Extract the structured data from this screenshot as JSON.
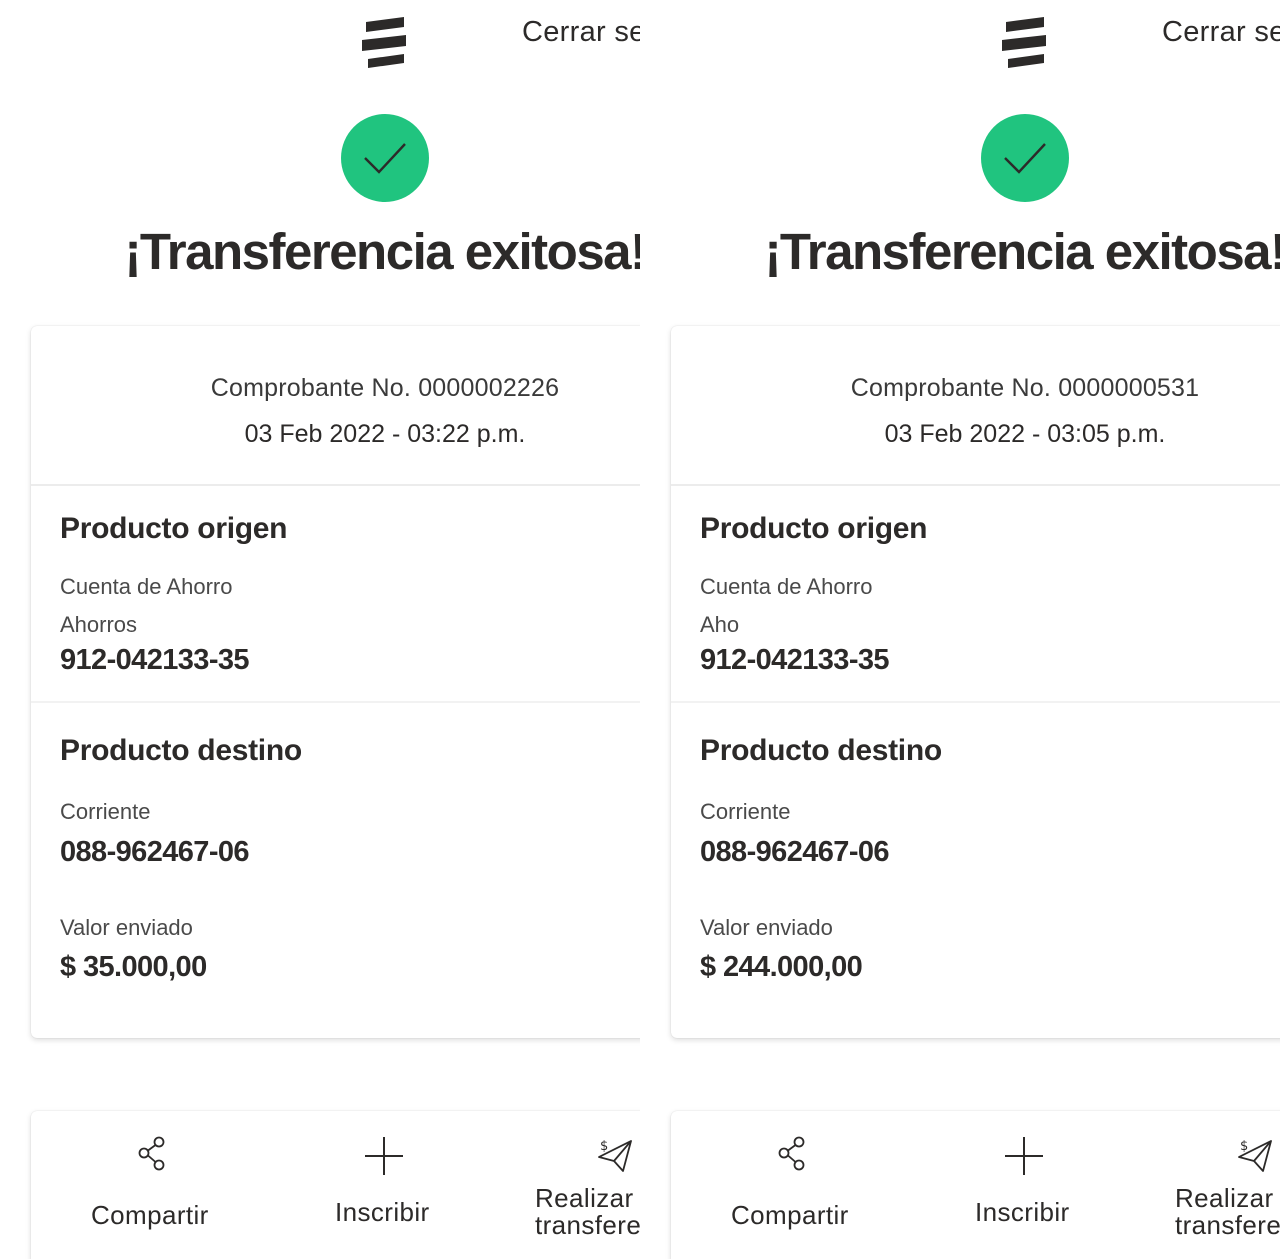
{
  "header": {
    "logout_label": "Cerrar se"
  },
  "title": "¡Transferencia exitosa!",
  "icons": {
    "logo": "bancolombia-logo",
    "success": "check-circle-icon",
    "share": "share-icon",
    "enroll": "plus-icon",
    "transfer": "send-money-icon"
  },
  "colors": {
    "success": "#20c47f",
    "text": "#2c2a29"
  },
  "receipts": [
    {
      "receipt_number": "Comprobante No. 0000002226",
      "datetime": "03 Feb 2022 - 03:22 p.m.",
      "origin": {
        "heading": "Producto origen",
        "type": "Cuenta de Ahorro",
        "subtype": "Ahorros",
        "account": "912-042133-35"
      },
      "destination": {
        "heading": "Producto destino",
        "type": "Corriente",
        "account": "088-962467-06"
      },
      "amount": {
        "label": "Valor enviado",
        "value": "$ 35.000,00"
      }
    },
    {
      "receipt_number": "Comprobante No. 0000000531",
      "datetime": "03 Feb 2022 - 03:05 p.m.",
      "origin": {
        "heading": "Producto origen",
        "type": "Cuenta de Ahorro",
        "subtype": "Aho",
        "account": "912-042133-35"
      },
      "destination": {
        "heading": "Producto destino",
        "type": "Corriente",
        "account": "088-962467-06"
      },
      "amount": {
        "label": "Valor enviado",
        "value": "$ 244.000,00"
      }
    }
  ],
  "actions": {
    "share_label": "Compartir",
    "enroll_label": "Inscribir",
    "transfer_label_line1": "Realizar",
    "transfer_label_line2": "transfere"
  }
}
